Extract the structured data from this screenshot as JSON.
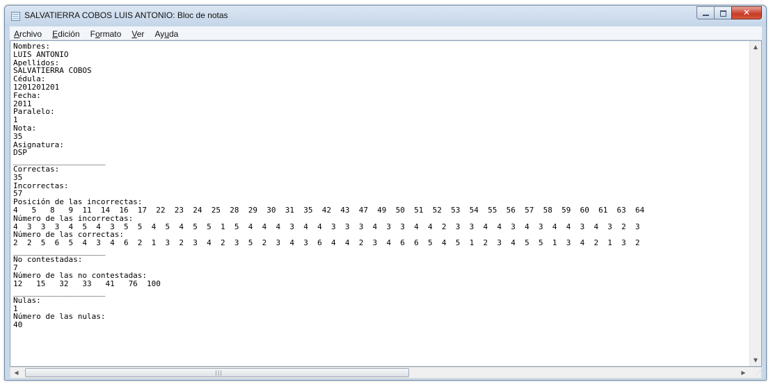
{
  "window": {
    "title": "SALVATIERRA COBOS LUIS ANTONIO: Bloc de notas"
  },
  "icons": {
    "app": "notepad-icon",
    "minimize": "minimize-icon",
    "maximize": "maximize-icon",
    "close": "close-icon",
    "scroll_up": "chevron-up-icon",
    "scroll_down": "chevron-down-icon",
    "scroll_left": "chevron-left-icon",
    "scroll_right": "chevron-right-icon"
  },
  "colors": {
    "close_button": "#c63a25",
    "title_bar": "#c4d5e9"
  },
  "menu": {
    "archivo": {
      "u": "A",
      "rest": "rchivo"
    },
    "edicion": {
      "u": "E",
      "rest": "dición"
    },
    "formato": {
      "pre": "F",
      "u": "o",
      "rest": "rmato"
    },
    "ver": {
      "u": "V",
      "rest": "er"
    },
    "ayuda": {
      "pre": "Ay",
      "u": "u",
      "rest": "da"
    }
  },
  "document": {
    "text": "Nombres:\nLUIS ANTONIO\nApellidos:\nSALVATIERRA COBOS\nCédula:\n1201201201\nFecha:\n2011\nParalelo:\n1\nNota:\n35\nAsignatura:\nDSP\n____________________\nCorrectas:\n35\nIncorrectas:\n57\nPosición de las incorrectas:\n4   5   8   9  11  14  16  17  22  23  24  25  28  29  30  31  35  42  43  47  49  50  51  52  53  54  55  56  57  58  59  60  61  63  64\nNúmero de las incorrectas:\n4  3  3  3  4  5  4  3  5  5  4  5  4  5  5  1  5  4  4  4  3  4  4  3  3  3  4  3  3  4  4  2  3  3  4  4  3  4  3  4  4  3  4  3  2  3\nNúmero de las correctas:\n2  2  5  6  5  4  3  4  6  2  1  3  2  3  4  2  3  5  2  3  4  3  6  4  4  2  3  4  6  6  5  4  5  1  2  3  4  5  5  1  3  4  2  1  3  2\n____________________\nNo contestadas:\n7\nNúmero de las no contestadas:\n12   15   32   33   41   76  100\n____________________\nNulas:\n1\nNúmero de las nulas:\n40"
  }
}
